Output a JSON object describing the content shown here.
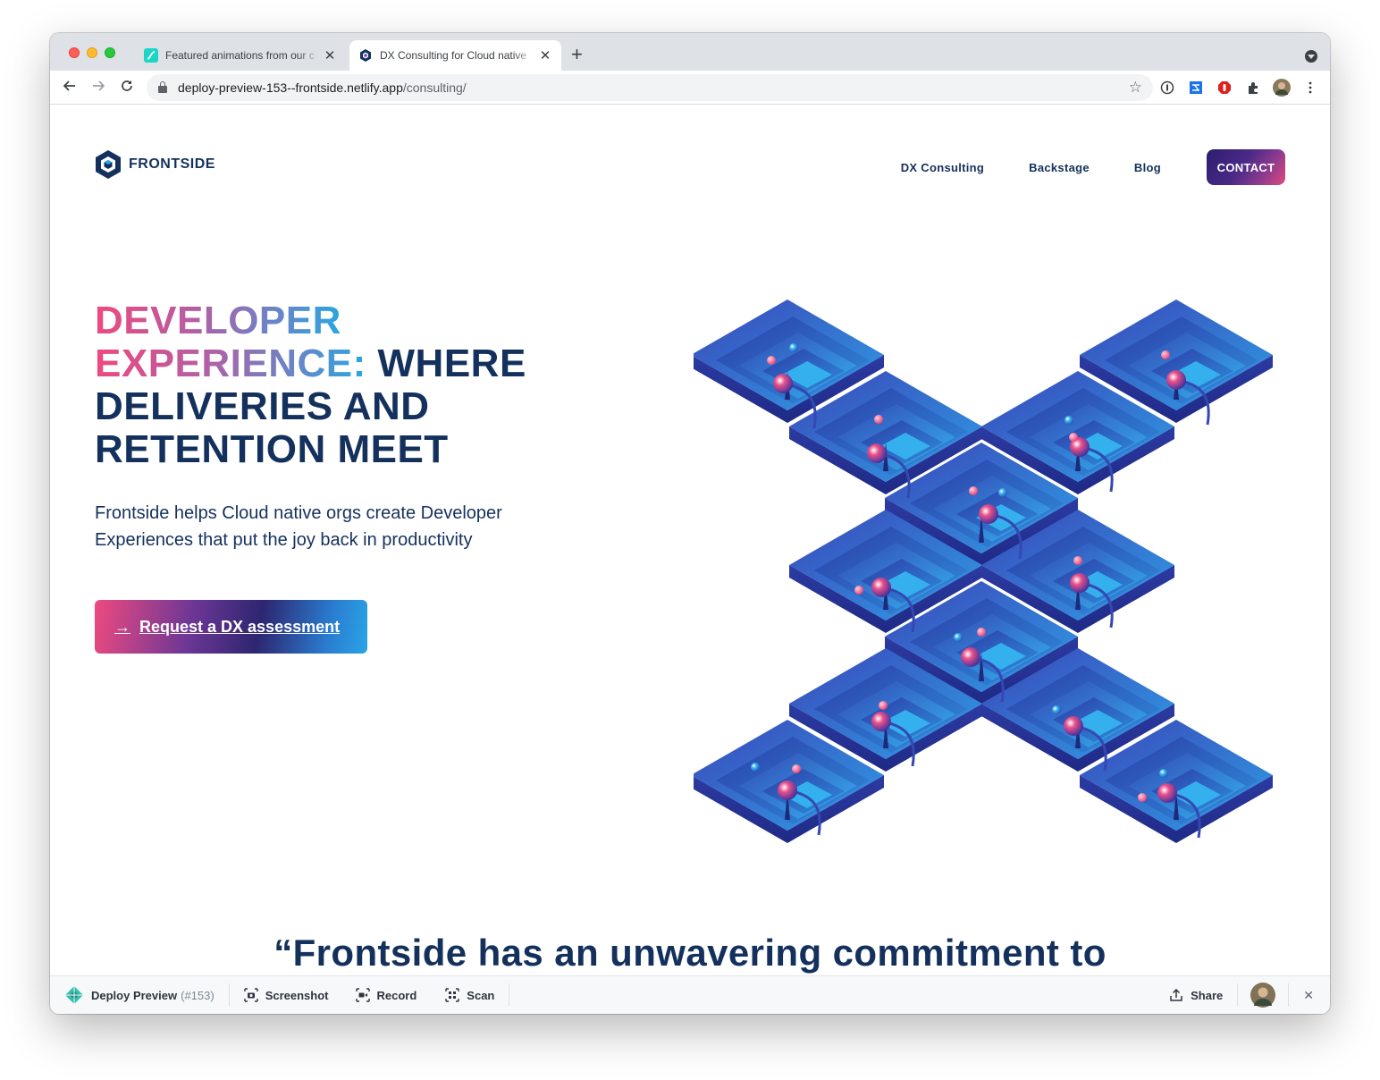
{
  "browser": {
    "tabs": [
      {
        "title": "Featured animations from our c",
        "active": false
      },
      {
        "title": "DX Consulting for Cloud native",
        "active": true
      }
    ],
    "new_tab": "+",
    "close_glyph": "✕",
    "url_host": "deploy-preview-153--frontside.netlify.app",
    "url_path": "/consulting/"
  },
  "site": {
    "logo_text": "FRONTSIDE",
    "nav": {
      "dx_consulting": "DX Consulting",
      "backstage": "Backstage",
      "blog": "Blog",
      "contact": "CONTACT"
    },
    "hero": {
      "title_line1": "DEVELOPER",
      "title_line2_grad": "EXPERIENCE:",
      "title_line2_rest": " WHERE",
      "title_line3": "DELIVERIES AND",
      "title_line4": "RETENTION MEET",
      "subtitle": "Frontside helps Cloud native orgs create Developer Experiences that put the joy back in productivity",
      "cta": "Request a DX assessment",
      "cta_arrow": "→"
    },
    "quote": "“Frontside has an unwavering commitment to"
  },
  "netlify_bar": {
    "deploy_label": "Deploy Preview",
    "deploy_number": "(#153)",
    "screenshot": "Screenshot",
    "record": "Record",
    "scan": "Scan",
    "share": "Share",
    "close_glyph": "✕"
  },
  "colors": {
    "navy": "#14315d",
    "pink": "#f0487d",
    "blue": "#26a8e3",
    "purple": "#4a2a86"
  }
}
